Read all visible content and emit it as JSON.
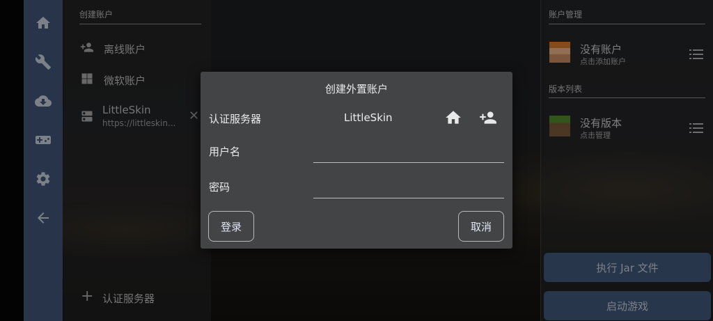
{
  "left_panel": {
    "section_title": "创建账户",
    "items": [
      {
        "icon": "person-add-icon",
        "label": "离线账户"
      },
      {
        "icon": "windows-icon",
        "label": "微软账户"
      },
      {
        "icon": "server-icon",
        "label": "LittleSkin",
        "sublabel": "https://littleskin..."
      }
    ],
    "add_server_label": "认证服务器"
  },
  "sidebar": {
    "items": [
      "home-icon",
      "wrench-icon",
      "cloud-download-icon",
      "gamepad-icon",
      "settings-icon",
      "back-arrow-icon"
    ]
  },
  "right_panel": {
    "account_section_title": "账户管理",
    "account_title": "没有账户",
    "account_subtitle": "点击添加账户",
    "version_section_title": "版本列表",
    "version_title": "没有版本",
    "version_subtitle": "点击管理",
    "jar_button_label": "执行 Jar 文件",
    "launch_button_label": "启动游戏"
  },
  "dialog": {
    "title": "创建外置账户",
    "server_label": "认证服务器",
    "server_value": "LittleSkin",
    "username_label": "用户名",
    "username_value": "",
    "password_label": "密码",
    "password_value": "",
    "login_label": "登录",
    "cancel_label": "取消"
  }
}
